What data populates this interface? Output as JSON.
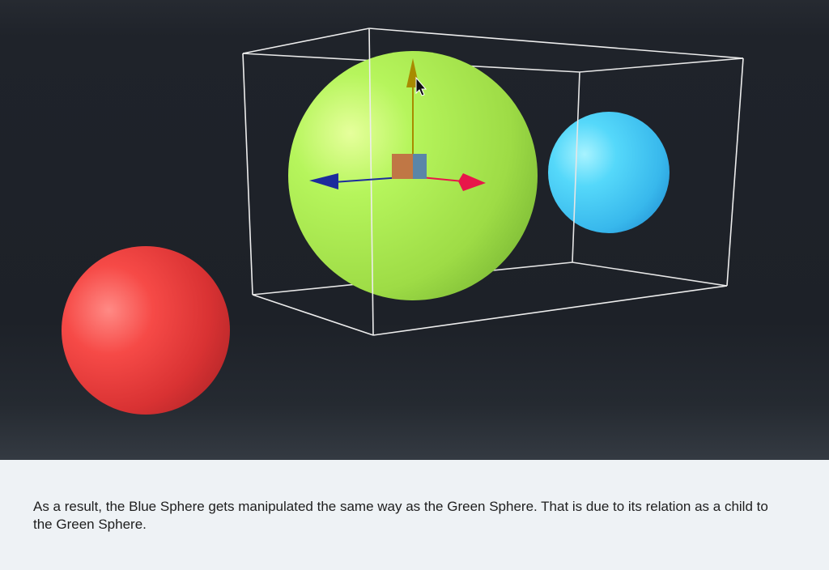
{
  "scene": {
    "objects": [
      {
        "name": "Green Sphere",
        "color": "#a6ec4e",
        "state": "selected"
      },
      {
        "name": "Blue Sphere",
        "color": "#4fd3f6",
        "relation": "child of Green Sphere"
      },
      {
        "name": "Red Sphere",
        "color": "#f0403e"
      }
    ],
    "gizmo": {
      "type": "translate",
      "axis_colors": {
        "x": "#e8164a",
        "y": "#a88a00",
        "z": "#1c2c9c"
      },
      "center_colors": [
        "#c07745",
        "#5a86a8"
      ]
    },
    "selection_box_color": "#e8e8e8"
  },
  "caption": {
    "text": "As a result, the Blue Sphere gets manipulated the same way as the Green Sphere. That is due to its relation as a child to the Green Sphere."
  }
}
